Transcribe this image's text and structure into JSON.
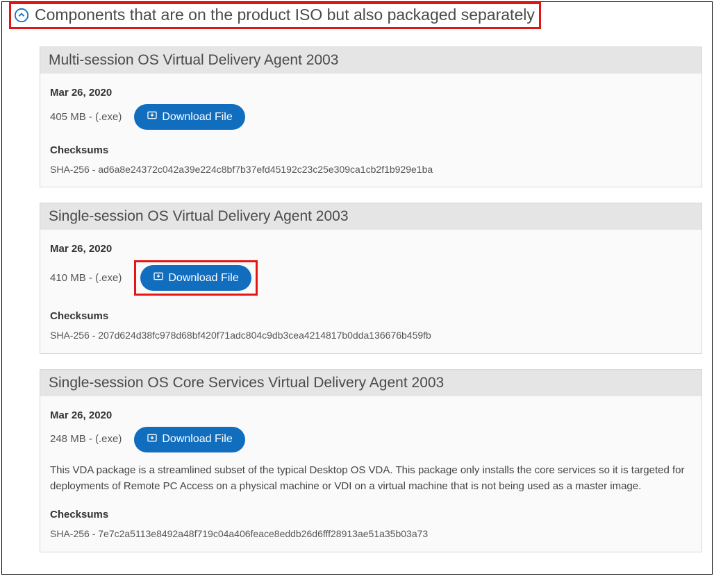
{
  "header": {
    "title": "Components that are on the product ISO but also packaged separately"
  },
  "common": {
    "download_label": "Download File",
    "checksums_label": "Checksums"
  },
  "cards": [
    {
      "title": "Multi-session OS Virtual Delivery Agent 2003",
      "date": "Mar 26, 2020",
      "file_meta": "405 MB - (.exe)",
      "hash": "SHA-256 - ad6a8e24372c042a39e224c8bf7b37efd45192c23c25e309ca1cb2f1b929e1ba"
    },
    {
      "title": "Single-session OS Virtual Delivery Agent 2003",
      "date": "Mar 26, 2020",
      "file_meta": "410 MB - (.exe)",
      "hash": "SHA-256 - 207d624d38fc978d68bf420f71adc804c9db3cea4214817b0dda136676b459fb"
    },
    {
      "title": "Single-session OS Core Services Virtual Delivery Agent 2003",
      "date": "Mar 26, 2020",
      "file_meta": "248 MB - (.exe)",
      "description": "This VDA package is a streamlined subset of the typical Desktop OS VDA. This package only installs the core services so it is targeted for deployments of Remote PC Access on a physical machine or VDI on a virtual machine that is not being used as a master image.",
      "hash": "SHA-256 - 7e7c2a5113e8492a48f719c04a406feace8eddb26d6fff28913ae51a35b03a73"
    }
  ]
}
